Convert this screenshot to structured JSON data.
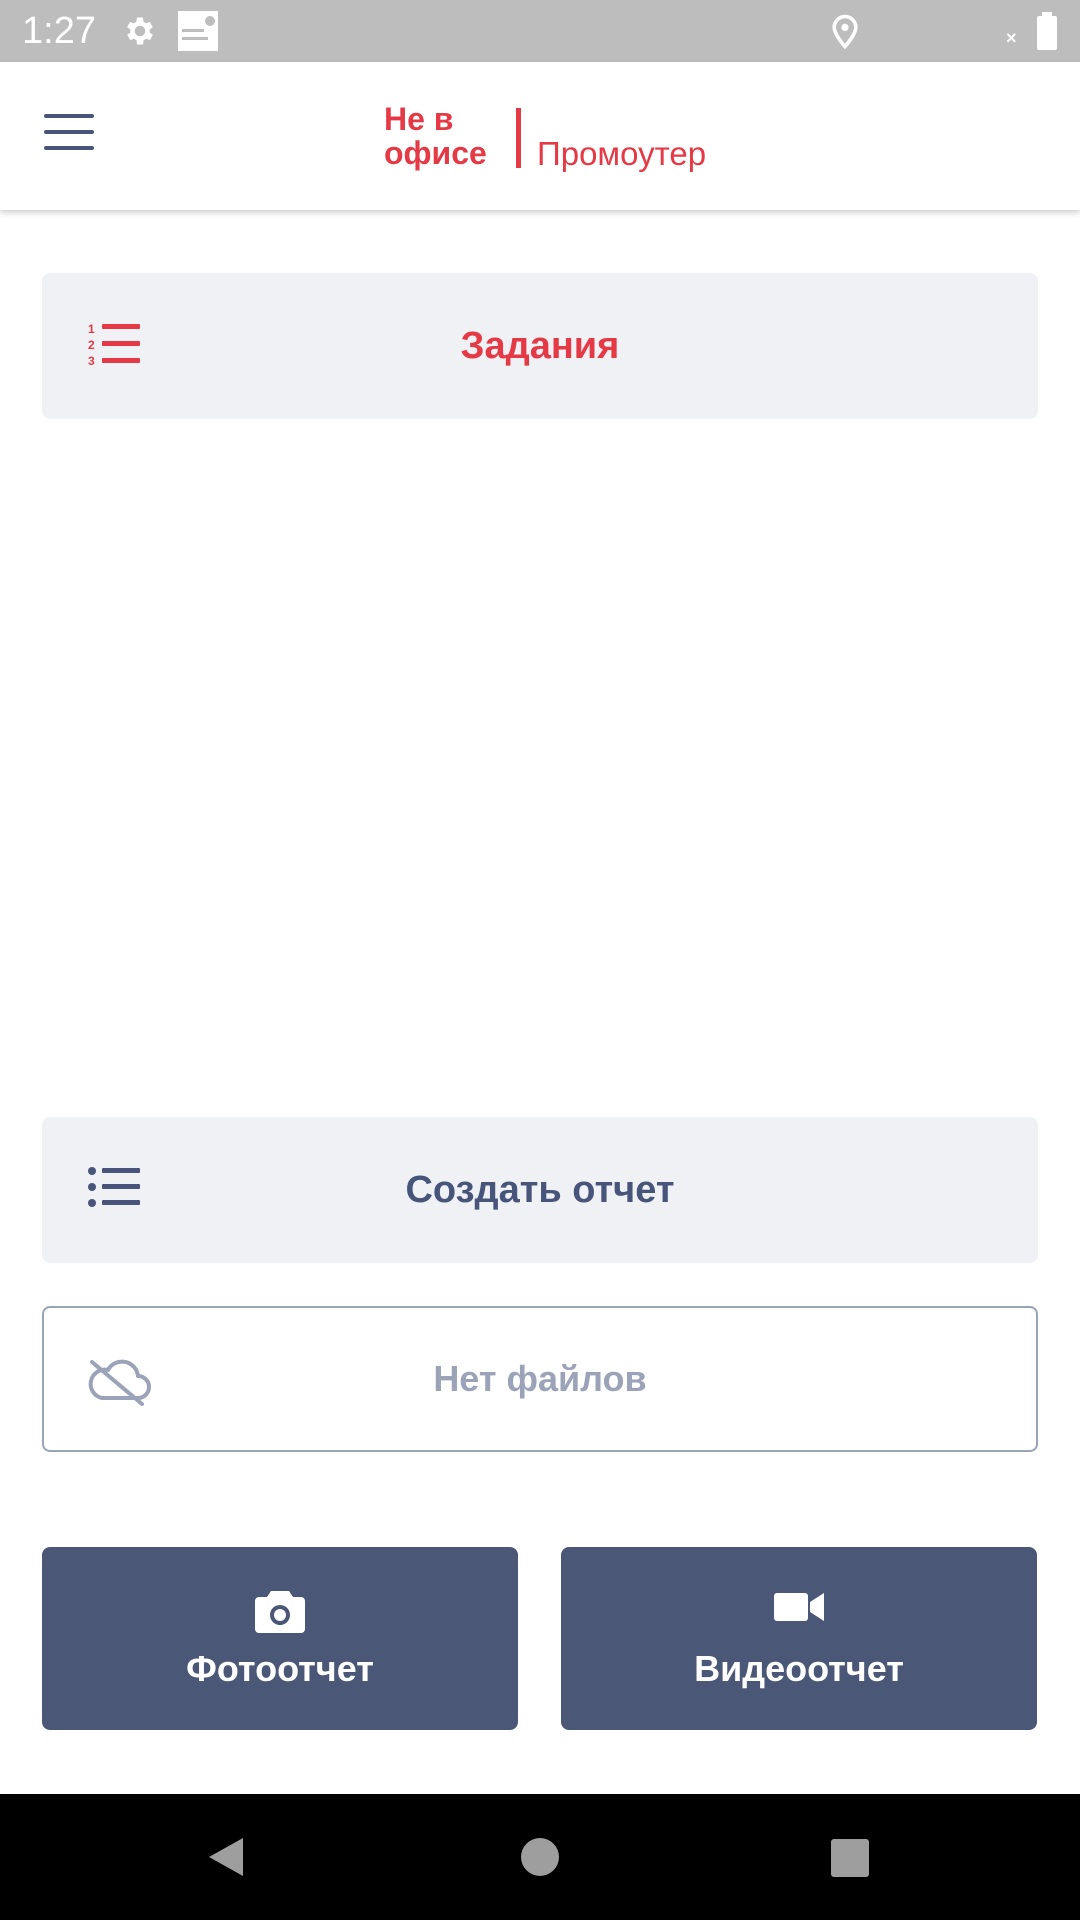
{
  "status_bar": {
    "time": "1:27",
    "icons": [
      "gear-icon",
      "app-notification-icon",
      "location-icon",
      "no-connection-icon",
      "battery-icon"
    ]
  },
  "app_bar": {
    "menu_icon": "hamburger-menu-icon",
    "logo_line1": "Не в",
    "logo_line2": "офисе",
    "logo_role": "Промоутер",
    "brand_color": "#e53a45"
  },
  "tasks_card": {
    "icon": "numbered-list-icon",
    "label": "Задания"
  },
  "report_card": {
    "icon": "bulleted-list-icon",
    "label": "Создать отчет"
  },
  "files_card": {
    "icon": "cloud-off-icon",
    "label": "Нет файлов"
  },
  "actions": {
    "photo": {
      "icon": "camera-icon",
      "label": "Фотоотчет"
    },
    "video": {
      "icon": "video-camera-icon",
      "label": "Видеоотчет"
    }
  },
  "nav_bar": {
    "icons": [
      "back-icon",
      "home-icon",
      "recents-icon"
    ]
  },
  "colors": {
    "accent": "#e53a45",
    "primary": "#4a5777",
    "card_bg": "#f0f1f5",
    "muted": "#9aa3b8"
  }
}
